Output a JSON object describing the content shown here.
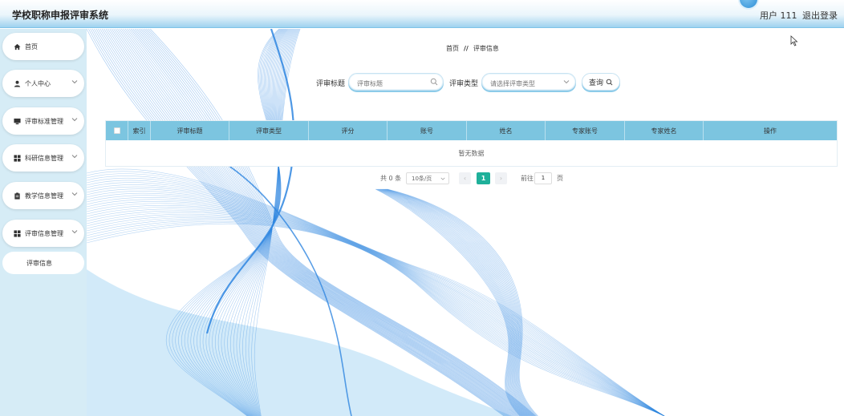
{
  "header": {
    "app_title": "学校职称申报评审系统",
    "user_name": "用户 111",
    "logout_label": "退出登录"
  },
  "sidebar": {
    "items": [
      {
        "label": "首页",
        "icon": "home-icon"
      },
      {
        "label": "个人中心",
        "icon": "user-icon"
      },
      {
        "label": "评审标准管理",
        "icon": "monitor-icon"
      },
      {
        "label": "科研信息管理",
        "icon": "grid-icon"
      },
      {
        "label": "教学信息管理",
        "icon": "clipboard-icon"
      },
      {
        "label": "评审信息管理",
        "icon": "grid-icon"
      }
    ],
    "sub_items": [
      {
        "label": "评审信息"
      }
    ]
  },
  "breadcrumb": {
    "home": "首页",
    "separator": "//",
    "current": "评审信息"
  },
  "search": {
    "title_label": "评审标题",
    "title_placeholder": "评审标题",
    "type_label": "评审类型",
    "type_placeholder": "请选择评审类型",
    "query_button": "查询"
  },
  "table": {
    "columns": [
      "索引",
      "评审标题",
      "评审类型",
      "评分",
      "账号",
      "姓名",
      "专家账号",
      "专家姓名",
      "操作"
    ],
    "empty_text": "暂无数据"
  },
  "pagination": {
    "total_text": "共 0 条",
    "page_size": "10条/页",
    "prev_label": "‹",
    "current_page": "1",
    "next_label": "›",
    "goto_label": "前往",
    "goto_value": "1",
    "goto_unit": "页"
  },
  "colors": {
    "header_gradient_end": "#9fd2ef",
    "sidebar_bg": "#d6ecf6",
    "table_header": "#7cc5e0",
    "page_active": "#1fb09a",
    "wave_blue": "#2f86e0"
  }
}
